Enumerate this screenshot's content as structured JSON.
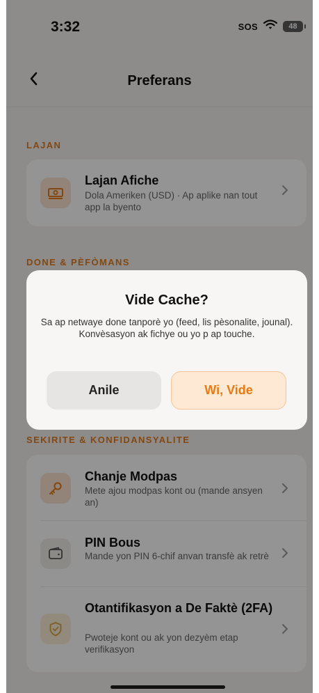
{
  "status_bar": {
    "time": "3:32",
    "sos": "SOS",
    "battery": "48"
  },
  "nav": {
    "back_glyph": "<",
    "title": "Preferans"
  },
  "sections": {
    "lajan": {
      "label": "LAJAN",
      "items": [
        {
          "title": "Lajan Afiche",
          "subtitle": "Dola Ameriken (USD) · Ap aplike nan tout app la byento",
          "icon": "banknote-icon"
        }
      ]
    },
    "done": {
      "label": "DONE & PÈFÒMANS"
    },
    "sekirite": {
      "label": "SEKIRITE & KONFIDANSYALITE",
      "items": [
        {
          "title": "Chanje Modpas",
          "subtitle": "Mete ajou modpas kont ou (mande ansyen an)",
          "icon": "key-icon"
        },
        {
          "title": "PIN Bous",
          "subtitle": "Mande yon PIN 6-chif anvan transfè ak retrè",
          "icon": "wallet-icon"
        },
        {
          "title": "Otantifikasyon a De Faktè (2FA)",
          "subtitle": "Pwoteje kont ou ak yon dezyèm etap verifikasyon",
          "icon": "shield-check-icon"
        }
      ]
    }
  },
  "dialog": {
    "title": "Vide Cache?",
    "message": "Sa ap netwaye done tanporè yo (feed, lis pèsonalite, jounal). Konvèsasyon ak fichye ou yo p ap touche.",
    "cancel_label": "Anile",
    "confirm_label": "Wi, Vide"
  },
  "colors": {
    "accent": "#e27c1e",
    "confirm_bg": "#fde9d4",
    "background": "#f3f2f0"
  }
}
